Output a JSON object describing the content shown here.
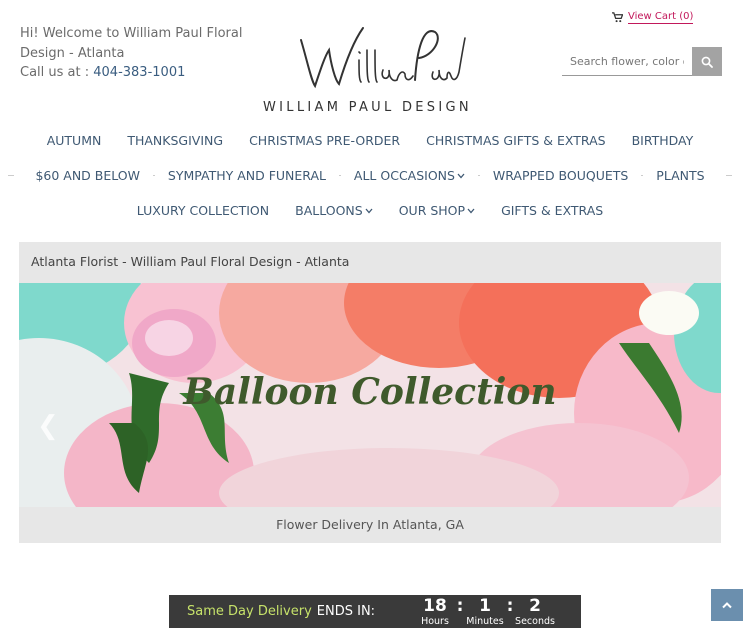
{
  "header": {
    "welcome_text": "Hi! Welcome to William Paul Floral Design - Atlanta",
    "call_label": "Call us at : ",
    "phone": "404-383-1001",
    "logo_tagline": "WILLIAM PAUL DESIGN",
    "logo_script": "William Paul",
    "cart_label": "View Cart (0)",
    "search_placeholder": "Search flower, color o"
  },
  "nav": {
    "row1": [
      "AUTUMN",
      "THANKSGIVING",
      "CHRISTMAS PRE-ORDER",
      "CHRISTMAS GIFTS & EXTRAS",
      "BIRTHDAY"
    ],
    "row2": [
      "$60 AND BELOW",
      "SYMPATHY AND FUNERAL",
      "ALL OCCASIONS",
      "WRAPPED BOUQUETS",
      "PLANTS"
    ],
    "row3": [
      "LUXURY COLLECTION",
      "BALLOONS",
      "OUR SHOP",
      "GIFTS & EXTRAS"
    ]
  },
  "breadcrumb": "Atlanta Florist - William Paul Floral Design - Atlanta",
  "hero": {
    "title": "Balloon Collection",
    "footer": "Flower Delivery In Atlanta, GA",
    "prev_glyph": "❮"
  },
  "countdown": {
    "label_highlight": "Same Day Delivery",
    "label_rest": "ENDS IN:",
    "hours": "18",
    "hours_label": "Hours",
    "minutes": "1",
    "minutes_label": "Minutes",
    "seconds": "2",
    "seconds_label": "Seconds",
    "separator": ":"
  },
  "colors": {
    "nav_text": "#3f5973",
    "cart_accent": "#c2185b",
    "countdown_highlight": "#c6e26a",
    "back_to_top": "#6b8fae"
  },
  "icons": [
    "shopping-cart-icon",
    "search-icon",
    "chevron-down-icon",
    "chevron-left-icon",
    "chevron-up-icon"
  ]
}
